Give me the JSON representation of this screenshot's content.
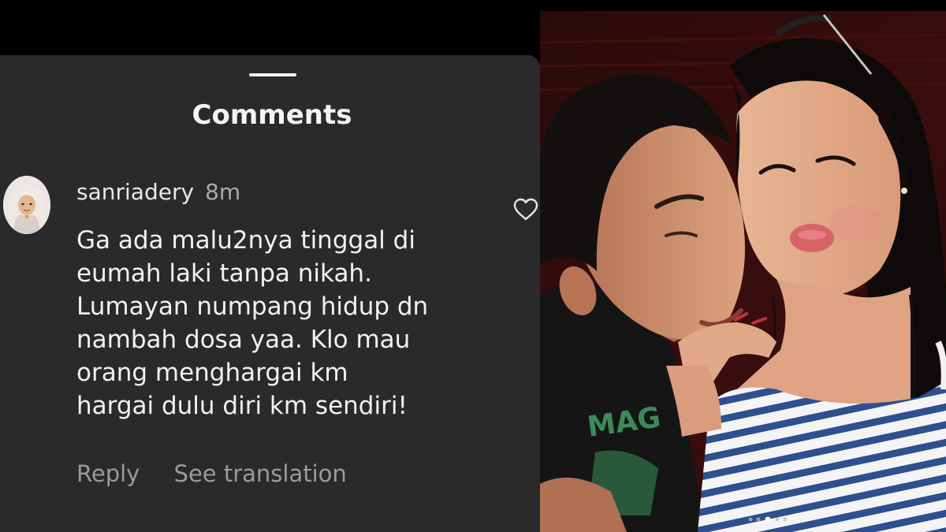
{
  "sheet": {
    "title": "Comments"
  },
  "comment": {
    "username": "sanriadery",
    "time": "8m",
    "text": "Ga ada malu2nya tinggal di\neumah laki tanpa nikah.\nLumayan numpang hidup dn\nnambah dosa yaa. Klo mau\norang menghargai km\nhargai dulu diri km sendiri!",
    "actions": {
      "reply_label": "Reply",
      "translate_label": "See translation"
    },
    "icons": {
      "like": "heart-outline-icon",
      "avatar": "user-avatar"
    }
  },
  "photo": {
    "shirt_print": "MAG",
    "carousel": {
      "count": 5,
      "active_index": 2
    }
  },
  "colors": {
    "sheet_background": "#2a2a2c",
    "text_primary": "#f2f2f2",
    "text_secondary": "#9a9a9a"
  }
}
